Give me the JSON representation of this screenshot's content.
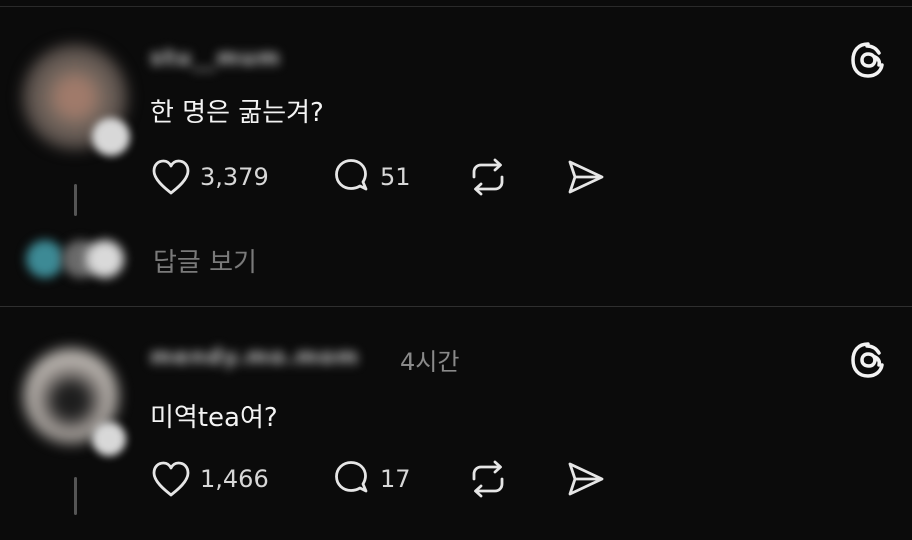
{
  "posts": [
    {
      "username": "stu__mum",
      "text": "한 명은 굶는겨?",
      "likes": "3,379",
      "comments": "51",
      "view_replies": "답글 보기"
    },
    {
      "username": "mendy.mo.mom",
      "timestamp": "4시간",
      "text": "미역tea여?",
      "likes": "1,466",
      "comments": "17"
    }
  ],
  "icons": {
    "like": "heart-icon",
    "comment": "speech-bubble-icon",
    "repost": "repost-icon",
    "share": "send-icon",
    "brand": "threads-logo-icon"
  },
  "colors": {
    "background": "#0b0b0b",
    "text": "#f3f3f3",
    "muted": "#7a7a7a"
  }
}
